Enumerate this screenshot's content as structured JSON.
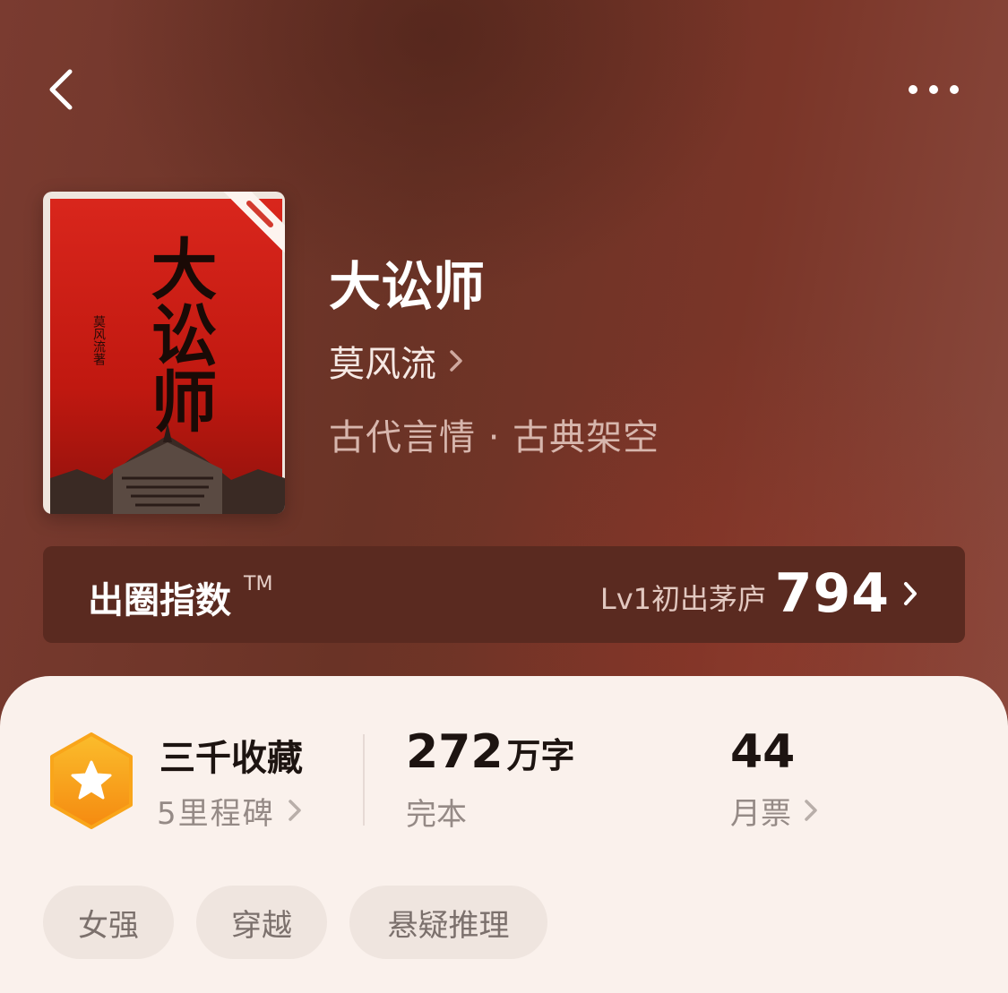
{
  "header": {
    "back_icon": "chevron-left-icon",
    "more_icon": "more-horizontal-icon"
  },
  "book": {
    "cover_title": "大讼师",
    "cover_author": "莫风流著",
    "title": "大讼师",
    "author": "莫风流",
    "genre": "古代言情 · 古典架空"
  },
  "index_bar": {
    "label": "出圈指数",
    "tm": "TM",
    "level": "Lv1初出茅庐",
    "score": "794"
  },
  "stats": {
    "collection": {
      "title": "三千收藏",
      "sub": "5里程碑",
      "icon": "star-badge-icon"
    },
    "words": {
      "value": "272",
      "unit": "万字",
      "sub": "完本"
    },
    "tickets": {
      "value": "44",
      "sub": "月票"
    }
  },
  "tags": [
    "女强",
    "穿越",
    "悬疑推理"
  ],
  "colors": {
    "hero_bg": "#6e3427",
    "panel_bg": "#faf1ec",
    "badge": "#f7a21b",
    "index_bar": "#5a2a20"
  }
}
